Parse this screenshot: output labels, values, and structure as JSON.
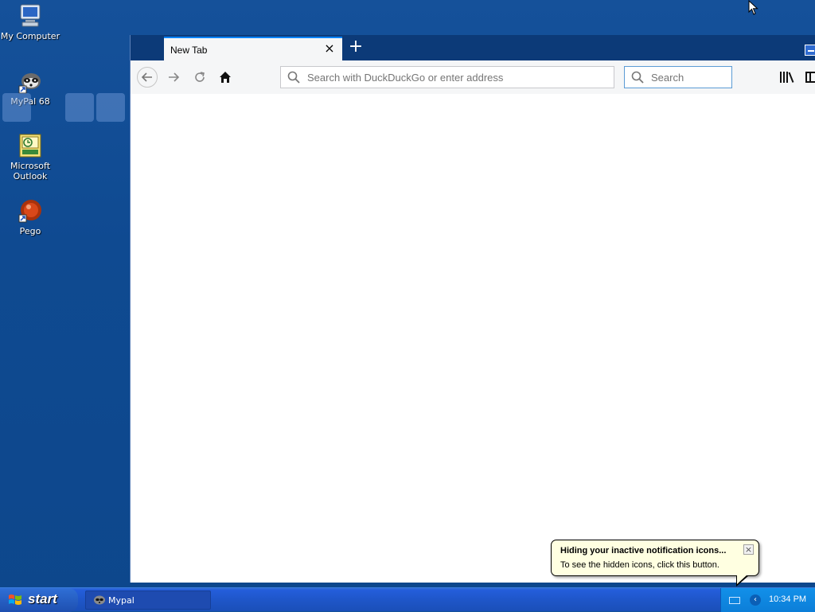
{
  "desktop": {
    "icons": [
      {
        "label": "My Computer",
        "icon": "my-computer-icon"
      },
      {
        "label": "MyPal 68",
        "icon": "raccoon-icon"
      },
      {
        "label": "Microsoft Outlook",
        "icon": "outlook-icon"
      },
      {
        "label": "Pego",
        "icon": "pego-icon"
      }
    ]
  },
  "browser": {
    "tab": {
      "title": "New Tab",
      "close_label": "×"
    },
    "new_tab_label": "+",
    "address": {
      "placeholder": "Search with DuckDuckGo or enter address",
      "value": ""
    },
    "search": {
      "placeholder": "Search",
      "value": ""
    }
  },
  "balloon": {
    "title": "Hiding your inactive notification icons...",
    "text": "To see the hidden icons, click this button.",
    "close_label": "×"
  },
  "taskbar": {
    "start_label": "start",
    "task_label": "Mypal",
    "clock": "10:34 PM",
    "tray_chevron": "‹"
  },
  "colors": {
    "accent": "#0a84ff",
    "desktop_bg": "#0f4a91",
    "balloon_bg": "#ffffe1"
  }
}
